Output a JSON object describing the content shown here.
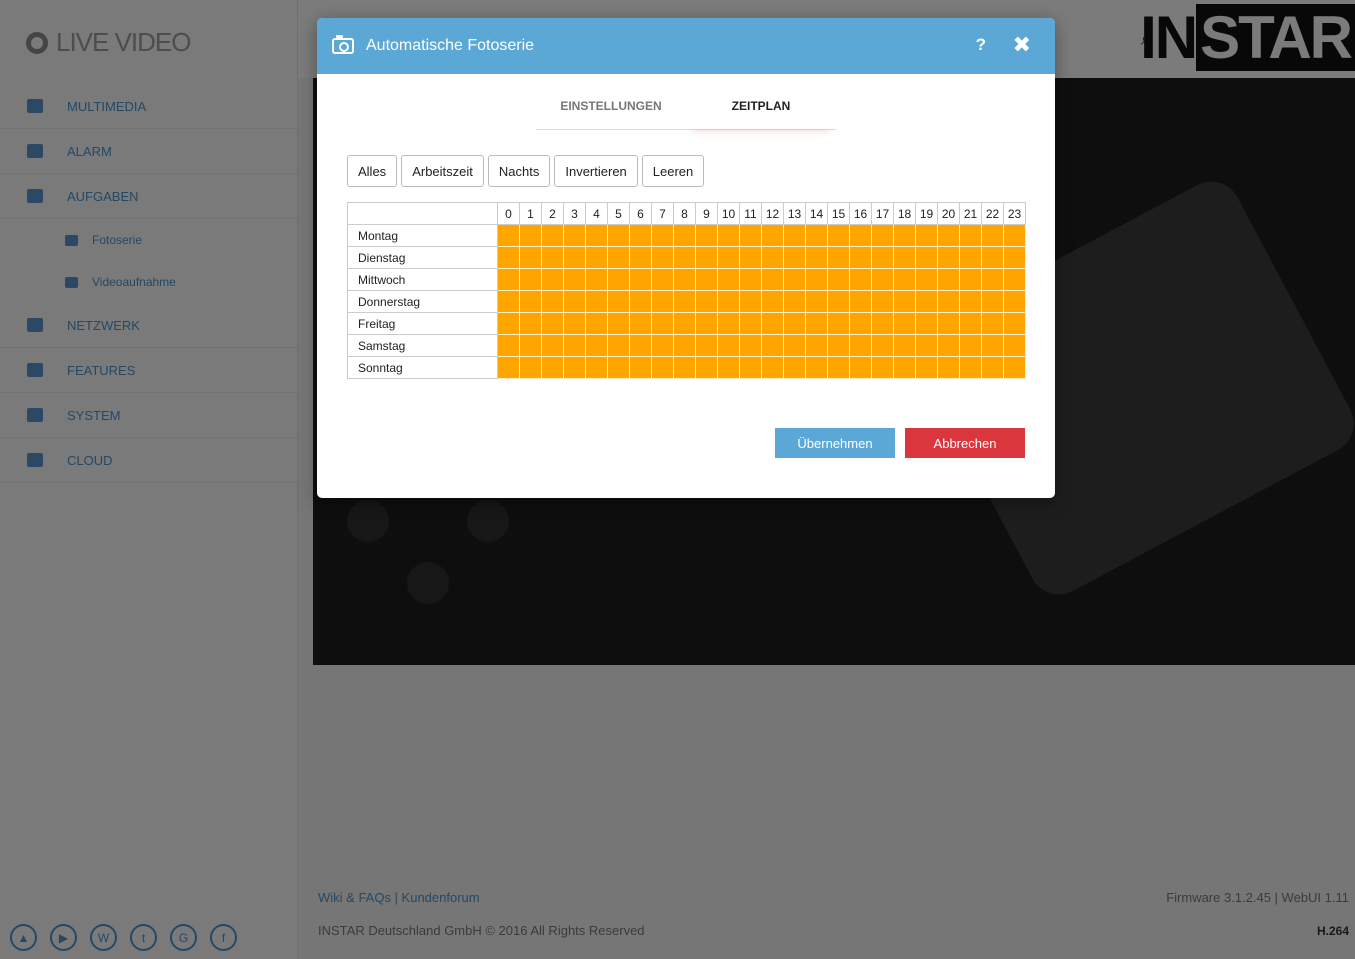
{
  "app": {
    "logo_text": "LIVE VIDEO",
    "brand": {
      "part1": "IN",
      "part2": "STAR"
    },
    "nav": [
      {
        "label": "MULTIMEDIA",
        "icon": "image-icon"
      },
      {
        "label": "ALARM",
        "icon": "bell-icon"
      },
      {
        "label": "AUFGABEN",
        "icon": "film-icon"
      },
      {
        "label": "Fotoserie",
        "icon": "camera-icon",
        "sub": true
      },
      {
        "label": "Videoaufnahme",
        "icon": "video-icon",
        "sub": true
      },
      {
        "label": "NETZWERK",
        "icon": "network-icon"
      },
      {
        "label": "FEATURES",
        "icon": "star-icon"
      },
      {
        "label": "SYSTEM",
        "icon": "gear-icon"
      },
      {
        "label": "CLOUD",
        "icon": "cloud-icon"
      }
    ],
    "footer": {
      "links": "Wiki & FAQs | Kundenforum",
      "copyright": "INSTAR Deutschland GmbH © 2016 All Rights Reserved",
      "firmware": "Firmware 3.1.2.45 | WebUI 1.11",
      "codec": "H.264"
    }
  },
  "modal": {
    "title": "Automatische Fotoserie",
    "help_label": "?",
    "close_label": "✖",
    "tabs": [
      {
        "label": "EINSTELLUNGEN",
        "active": false
      },
      {
        "label": "ZEITPLAN",
        "active": true
      }
    ],
    "presets": [
      "Alles",
      "Arbeitszeit",
      "Nachts",
      "Invertieren",
      "Leeren"
    ],
    "hours": [
      "0",
      "1",
      "2",
      "3",
      "4",
      "5",
      "6",
      "7",
      "8",
      "9",
      "10",
      "11",
      "12",
      "13",
      "14",
      "15",
      "16",
      "17",
      "18",
      "19",
      "20",
      "21",
      "22",
      "23"
    ],
    "days": [
      "Montag",
      "Dienstag",
      "Mittwoch",
      "Donnerstag",
      "Freitag",
      "Samstag",
      "Sonntag"
    ],
    "schedule_fill": "all-active",
    "active_color": "#ffa500",
    "apply_label": "Übernehmen",
    "cancel_label": "Abbrechen"
  }
}
